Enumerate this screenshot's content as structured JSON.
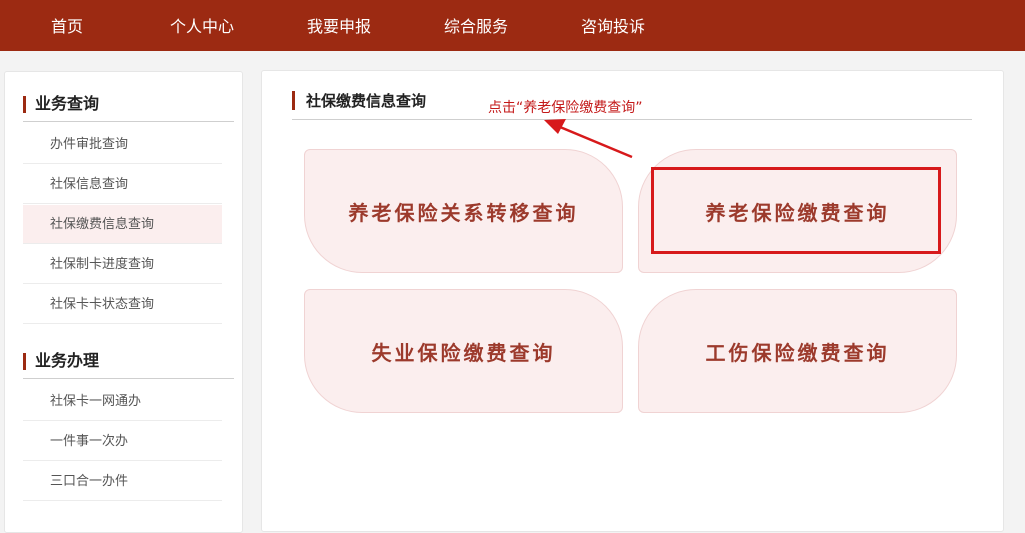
{
  "nav": {
    "items": [
      "首页",
      "个人中心",
      "我要申报",
      "综合服务",
      "咨询投诉"
    ]
  },
  "sidebar": {
    "sections": [
      {
        "title": "业务查询",
        "items": [
          "办件审批查询",
          "社保信息查询",
          "社保缴费信息查询",
          "社保制卡进度查询",
          "社保卡卡状态查询"
        ]
      },
      {
        "title": "业务办理",
        "items": [
          "社保卡一网通办",
          "一件事一次办",
          "三口合一办件"
        ]
      }
    ],
    "active_item": "社保缴费信息查询"
  },
  "main": {
    "title": "社保缴费信息查询",
    "hint": "点击“养老保险缴费查询”",
    "cards": [
      "养老保险关系转移查询",
      "养老保险缴费查询",
      "失业保险缴费查询",
      "工伤保险缴费查询"
    ]
  },
  "colors": {
    "nav_bg": "#9c2a12",
    "card_bg": "#fbeeee",
    "card_text": "#9c3a2c",
    "annotation_red": "#d7191b"
  }
}
